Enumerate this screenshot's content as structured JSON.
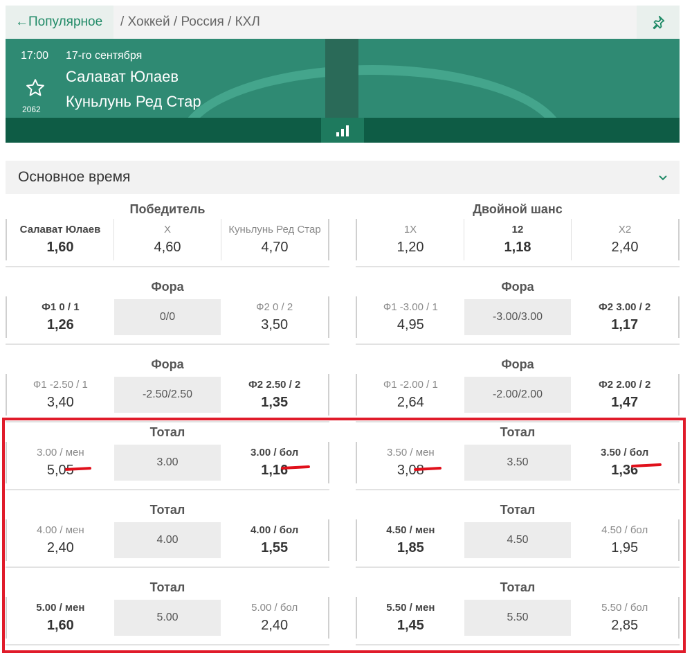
{
  "breadcrumb": {
    "back_label": "←Популярное",
    "path": "/ Хоккей / Россия / КХЛ"
  },
  "match": {
    "time": "17:00",
    "date": "17-го сентября",
    "home": "Салават Юлаев",
    "away": "Куньлунь Ред Стар",
    "match_id": "2062"
  },
  "section": {
    "title": "Основное время"
  },
  "markets": [
    {
      "title": "Победитель",
      "cells": [
        {
          "name": "Салават Юлаев",
          "odd": "1,60",
          "bold": true
        },
        {
          "name": "X",
          "odd": "4,60"
        },
        {
          "name": "Куньлунь Ред Стар",
          "odd": "4,70"
        }
      ]
    },
    {
      "title": "Двойной шанс",
      "cells": [
        {
          "name": "1X",
          "odd": "1,20"
        },
        {
          "name": "12",
          "odd": "1,18",
          "bold": true
        },
        {
          "name": "X2",
          "odd": "2,40"
        }
      ]
    },
    {
      "title": "Фора",
      "cells": [
        {
          "name": "Ф1 0 / 1",
          "odd": "1,26",
          "bold": true
        },
        {
          "line": "0/0"
        },
        {
          "name": "Ф2 0 / 2",
          "odd": "3,50"
        }
      ]
    },
    {
      "title": "Фора",
      "cells": [
        {
          "name": "Ф1 -3.00 / 1",
          "odd": "4,95"
        },
        {
          "line": "-3.00/3.00"
        },
        {
          "name": "Ф2 3.00 / 2",
          "odd": "1,17",
          "bold": true
        }
      ]
    },
    {
      "title": "Фора",
      "cells": [
        {
          "name": "Ф1 -2.50 / 1",
          "odd": "3,40"
        },
        {
          "line": "-2.50/2.50"
        },
        {
          "name": "Ф2 2.50 / 2",
          "odd": "1,35",
          "bold": true
        }
      ]
    },
    {
      "title": "Фора",
      "cells": [
        {
          "name": "Ф1 -2.00 / 1",
          "odd": "2,64"
        },
        {
          "line": "-2.00/2.00"
        },
        {
          "name": "Ф2 2.00 / 2",
          "odd": "1,47",
          "bold": true
        }
      ]
    },
    {
      "title": "Тотал",
      "cells": [
        {
          "name": "3.00 / мен",
          "odd": "5,05"
        },
        {
          "line": "3.00"
        },
        {
          "name": "3.00 / бол",
          "odd": "1,16",
          "bold": true
        }
      ]
    },
    {
      "title": "Тотал",
      "cells": [
        {
          "name": "3.50 / мен",
          "odd": "3,08"
        },
        {
          "line": "3.50"
        },
        {
          "name": "3.50 / бол",
          "odd": "1,36",
          "bold": true
        }
      ]
    },
    {
      "title": "Тотал",
      "cells": [
        {
          "name": "4.00 / мен",
          "odd": "2,40"
        },
        {
          "line": "4.00"
        },
        {
          "name": "4.00 / бол",
          "odd": "1,55",
          "bold": true
        }
      ]
    },
    {
      "title": "Тотал",
      "cells": [
        {
          "name": "4.50 / мен",
          "odd": "1,85",
          "bold": true
        },
        {
          "line": "4.50"
        },
        {
          "name": "4.50 / бол",
          "odd": "1,95"
        }
      ]
    },
    {
      "title": "Тотал",
      "cells": [
        {
          "name": "5.00 / мен",
          "odd": "1,60",
          "bold": true
        },
        {
          "line": "5.00"
        },
        {
          "name": "5.00 / бол",
          "odd": "2,40"
        }
      ]
    },
    {
      "title": "Тотал",
      "cells": [
        {
          "name": "5.50 / мен",
          "odd": "1,45",
          "bold": true
        },
        {
          "line": "5.50"
        },
        {
          "name": "5.50 / бол",
          "odd": "2,85"
        }
      ]
    }
  ],
  "colors": {
    "brand_green": "#2f8a73",
    "dark_green": "#0e5c45",
    "highlight_red": "#e01b2a"
  }
}
